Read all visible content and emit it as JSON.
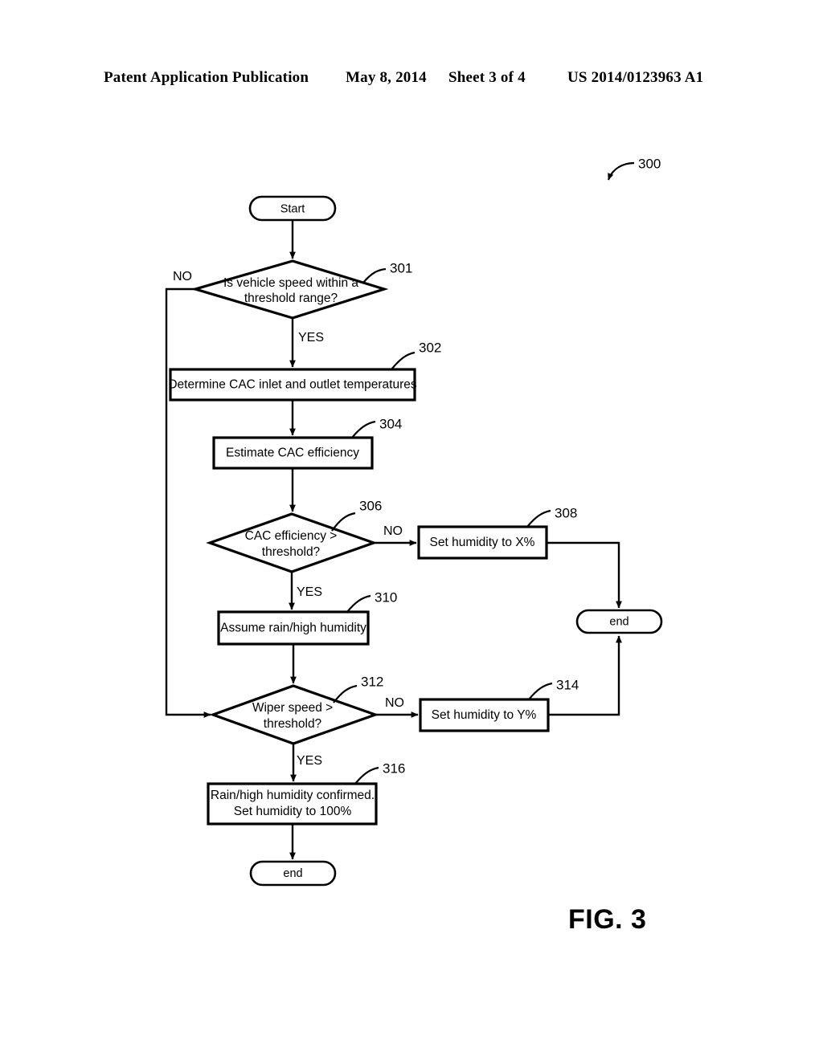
{
  "header": {
    "title": "Patent Application Publication",
    "date": "May 8, 2014",
    "sheet": "Sheet 3 of 4",
    "publication_number": "US 2014/0123963 A1"
  },
  "figure": {
    "label": "FIG. 3",
    "diagram_reference": "300"
  },
  "flowchart": {
    "type": "flowchart",
    "nodes": [
      {
        "id": "start",
        "ref": "",
        "kind": "terminator",
        "label": "Start"
      },
      {
        "id": "n301",
        "ref": "301",
        "kind": "decision",
        "line1": "Is vehicle speed within a",
        "line2": "threshold range?"
      },
      {
        "id": "n302",
        "ref": "302",
        "kind": "process",
        "line1": "Determine CAC inlet and outlet temperatures",
        "line2": ""
      },
      {
        "id": "n304",
        "ref": "304",
        "kind": "process",
        "line1": "Estimate CAC efficiency",
        "line2": ""
      },
      {
        "id": "n306",
        "ref": "306",
        "kind": "decision",
        "line1": "CAC efficiency >",
        "line2": "threshold?"
      },
      {
        "id": "n308",
        "ref": "308",
        "kind": "process",
        "line1": "Set humidity to X%",
        "line2": ""
      },
      {
        "id": "n310",
        "ref": "310",
        "kind": "process",
        "line1": "Assume rain/high humidity",
        "line2": ""
      },
      {
        "id": "n312",
        "ref": "312",
        "kind": "decision",
        "line1": "Wiper speed >",
        "line2": "threshold?"
      },
      {
        "id": "n314",
        "ref": "314",
        "kind": "process",
        "line1": "Set humidity to Y%",
        "line2": ""
      },
      {
        "id": "n316",
        "ref": "316",
        "kind": "process",
        "line1": "Rain/high humidity confirmed.",
        "line2": "Set humidity to 100%"
      },
      {
        "id": "end_right",
        "ref": "",
        "kind": "terminator",
        "label": "end"
      },
      {
        "id": "end_bottom",
        "ref": "",
        "kind": "terminator",
        "label": "end"
      }
    ],
    "edges": [
      {
        "from": "start",
        "to": "n301",
        "label": ""
      },
      {
        "from": "n301",
        "to": "n312",
        "label": "NO"
      },
      {
        "from": "n301",
        "to": "n302",
        "label": "YES"
      },
      {
        "from": "n302",
        "to": "n304",
        "label": ""
      },
      {
        "from": "n304",
        "to": "n306",
        "label": ""
      },
      {
        "from": "n306",
        "to": "n308",
        "label": "NO"
      },
      {
        "from": "n306",
        "to": "n310",
        "label": "YES"
      },
      {
        "from": "n308",
        "to": "end_right",
        "label": ""
      },
      {
        "from": "n310",
        "to": "n312",
        "label": ""
      },
      {
        "from": "n312",
        "to": "n314",
        "label": "NO"
      },
      {
        "from": "n312",
        "to": "n316",
        "label": "YES"
      },
      {
        "from": "n314",
        "to": "end_right",
        "label": ""
      },
      {
        "from": "n316",
        "to": "end_bottom",
        "label": ""
      }
    ],
    "branch_labels": {
      "no_301": "NO",
      "yes_301": "YES",
      "no_306": "NO",
      "yes_306": "YES",
      "no_312": "NO",
      "yes_312": "YES"
    },
    "reference_numerals": {
      "diagram": "300",
      "d301": "301",
      "b302": "302",
      "b304": "304",
      "d306": "306",
      "b308": "308",
      "b310": "310",
      "d312": "312",
      "b314": "314",
      "b316": "316"
    },
    "terminator_labels": {
      "start": "Start",
      "end_right": "end",
      "end_bottom": "end"
    }
  }
}
